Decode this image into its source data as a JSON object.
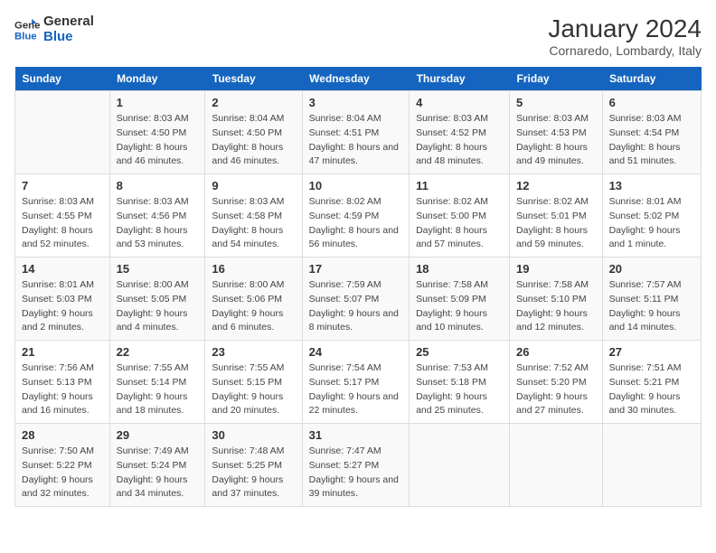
{
  "logo": {
    "text_general": "General",
    "text_blue": "Blue"
  },
  "header": {
    "title": "January 2024",
    "subtitle": "Cornaredo, Lombardy, Italy"
  },
  "weekdays": [
    "Sunday",
    "Monday",
    "Tuesday",
    "Wednesday",
    "Thursday",
    "Friday",
    "Saturday"
  ],
  "weeks": [
    [
      {
        "day": "",
        "sunrise": "",
        "sunset": "",
        "daylight": ""
      },
      {
        "day": "1",
        "sunrise": "Sunrise: 8:03 AM",
        "sunset": "Sunset: 4:50 PM",
        "daylight": "Daylight: 8 hours and 46 minutes."
      },
      {
        "day": "2",
        "sunrise": "Sunrise: 8:04 AM",
        "sunset": "Sunset: 4:50 PM",
        "daylight": "Daylight: 8 hours and 46 minutes."
      },
      {
        "day": "3",
        "sunrise": "Sunrise: 8:04 AM",
        "sunset": "Sunset: 4:51 PM",
        "daylight": "Daylight: 8 hours and 47 minutes."
      },
      {
        "day": "4",
        "sunrise": "Sunrise: 8:03 AM",
        "sunset": "Sunset: 4:52 PM",
        "daylight": "Daylight: 8 hours and 48 minutes."
      },
      {
        "day": "5",
        "sunrise": "Sunrise: 8:03 AM",
        "sunset": "Sunset: 4:53 PM",
        "daylight": "Daylight: 8 hours and 49 minutes."
      },
      {
        "day": "6",
        "sunrise": "Sunrise: 8:03 AM",
        "sunset": "Sunset: 4:54 PM",
        "daylight": "Daylight: 8 hours and 51 minutes."
      }
    ],
    [
      {
        "day": "7",
        "sunrise": "Sunrise: 8:03 AM",
        "sunset": "Sunset: 4:55 PM",
        "daylight": "Daylight: 8 hours and 52 minutes."
      },
      {
        "day": "8",
        "sunrise": "Sunrise: 8:03 AM",
        "sunset": "Sunset: 4:56 PM",
        "daylight": "Daylight: 8 hours and 53 minutes."
      },
      {
        "day": "9",
        "sunrise": "Sunrise: 8:03 AM",
        "sunset": "Sunset: 4:58 PM",
        "daylight": "Daylight: 8 hours and 54 minutes."
      },
      {
        "day": "10",
        "sunrise": "Sunrise: 8:02 AM",
        "sunset": "Sunset: 4:59 PM",
        "daylight": "Daylight: 8 hours and 56 minutes."
      },
      {
        "day": "11",
        "sunrise": "Sunrise: 8:02 AM",
        "sunset": "Sunset: 5:00 PM",
        "daylight": "Daylight: 8 hours and 57 minutes."
      },
      {
        "day": "12",
        "sunrise": "Sunrise: 8:02 AM",
        "sunset": "Sunset: 5:01 PM",
        "daylight": "Daylight: 8 hours and 59 minutes."
      },
      {
        "day": "13",
        "sunrise": "Sunrise: 8:01 AM",
        "sunset": "Sunset: 5:02 PM",
        "daylight": "Daylight: 9 hours and 1 minute."
      }
    ],
    [
      {
        "day": "14",
        "sunrise": "Sunrise: 8:01 AM",
        "sunset": "Sunset: 5:03 PM",
        "daylight": "Daylight: 9 hours and 2 minutes."
      },
      {
        "day": "15",
        "sunrise": "Sunrise: 8:00 AM",
        "sunset": "Sunset: 5:05 PM",
        "daylight": "Daylight: 9 hours and 4 minutes."
      },
      {
        "day": "16",
        "sunrise": "Sunrise: 8:00 AM",
        "sunset": "Sunset: 5:06 PM",
        "daylight": "Daylight: 9 hours and 6 minutes."
      },
      {
        "day": "17",
        "sunrise": "Sunrise: 7:59 AM",
        "sunset": "Sunset: 5:07 PM",
        "daylight": "Daylight: 9 hours and 8 minutes."
      },
      {
        "day": "18",
        "sunrise": "Sunrise: 7:58 AM",
        "sunset": "Sunset: 5:09 PM",
        "daylight": "Daylight: 9 hours and 10 minutes."
      },
      {
        "day": "19",
        "sunrise": "Sunrise: 7:58 AM",
        "sunset": "Sunset: 5:10 PM",
        "daylight": "Daylight: 9 hours and 12 minutes."
      },
      {
        "day": "20",
        "sunrise": "Sunrise: 7:57 AM",
        "sunset": "Sunset: 5:11 PM",
        "daylight": "Daylight: 9 hours and 14 minutes."
      }
    ],
    [
      {
        "day": "21",
        "sunrise": "Sunrise: 7:56 AM",
        "sunset": "Sunset: 5:13 PM",
        "daylight": "Daylight: 9 hours and 16 minutes."
      },
      {
        "day": "22",
        "sunrise": "Sunrise: 7:55 AM",
        "sunset": "Sunset: 5:14 PM",
        "daylight": "Daylight: 9 hours and 18 minutes."
      },
      {
        "day": "23",
        "sunrise": "Sunrise: 7:55 AM",
        "sunset": "Sunset: 5:15 PM",
        "daylight": "Daylight: 9 hours and 20 minutes."
      },
      {
        "day": "24",
        "sunrise": "Sunrise: 7:54 AM",
        "sunset": "Sunset: 5:17 PM",
        "daylight": "Daylight: 9 hours and 22 minutes."
      },
      {
        "day": "25",
        "sunrise": "Sunrise: 7:53 AM",
        "sunset": "Sunset: 5:18 PM",
        "daylight": "Daylight: 9 hours and 25 minutes."
      },
      {
        "day": "26",
        "sunrise": "Sunrise: 7:52 AM",
        "sunset": "Sunset: 5:20 PM",
        "daylight": "Daylight: 9 hours and 27 minutes."
      },
      {
        "day": "27",
        "sunrise": "Sunrise: 7:51 AM",
        "sunset": "Sunset: 5:21 PM",
        "daylight": "Daylight: 9 hours and 30 minutes."
      }
    ],
    [
      {
        "day": "28",
        "sunrise": "Sunrise: 7:50 AM",
        "sunset": "Sunset: 5:22 PM",
        "daylight": "Daylight: 9 hours and 32 minutes."
      },
      {
        "day": "29",
        "sunrise": "Sunrise: 7:49 AM",
        "sunset": "Sunset: 5:24 PM",
        "daylight": "Daylight: 9 hours and 34 minutes."
      },
      {
        "day": "30",
        "sunrise": "Sunrise: 7:48 AM",
        "sunset": "Sunset: 5:25 PM",
        "daylight": "Daylight: 9 hours and 37 minutes."
      },
      {
        "day": "31",
        "sunrise": "Sunrise: 7:47 AM",
        "sunset": "Sunset: 5:27 PM",
        "daylight": "Daylight: 9 hours and 39 minutes."
      },
      {
        "day": "",
        "sunrise": "",
        "sunset": "",
        "daylight": ""
      },
      {
        "day": "",
        "sunrise": "",
        "sunset": "",
        "daylight": ""
      },
      {
        "day": "",
        "sunrise": "",
        "sunset": "",
        "daylight": ""
      }
    ]
  ]
}
